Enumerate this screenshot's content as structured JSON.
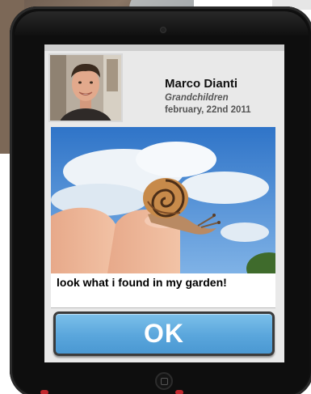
{
  "message": {
    "sender_name": "Marco Dianti",
    "relation": "Grandchildren",
    "date": "february, 22nd 2011",
    "caption": "look what i found in my garden!"
  },
  "actions": {
    "ok_label": "OK"
  },
  "images": {
    "avatar": "sender-profile-photo",
    "photo": "snail-on-fingertip-photo"
  },
  "colors": {
    "button": "#5aa6dc",
    "screen_bg": "#e9e9e9",
    "device": "#0e0e0e"
  }
}
